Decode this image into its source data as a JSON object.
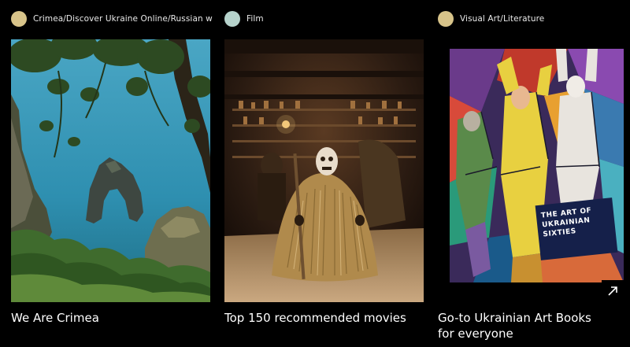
{
  "cards": [
    {
      "tag": "Crimea/Discover Ukraine Online/Russian war ag...",
      "tag_color": "#d8c48a",
      "title": "We Are Crimea"
    },
    {
      "tag": "Film",
      "tag_color": "#b6d3cc",
      "title": "Top 150 recommended movies"
    },
    {
      "tag": "Visual Art/Literature",
      "tag_color": "#d8c48a",
      "title": "Go-to Ukrainian Art Books for everyone",
      "book_label": "THE ART OF UKRAINIAN SIXTIES"
    }
  ],
  "icons": {
    "open": "arrow-up-right-icon"
  }
}
